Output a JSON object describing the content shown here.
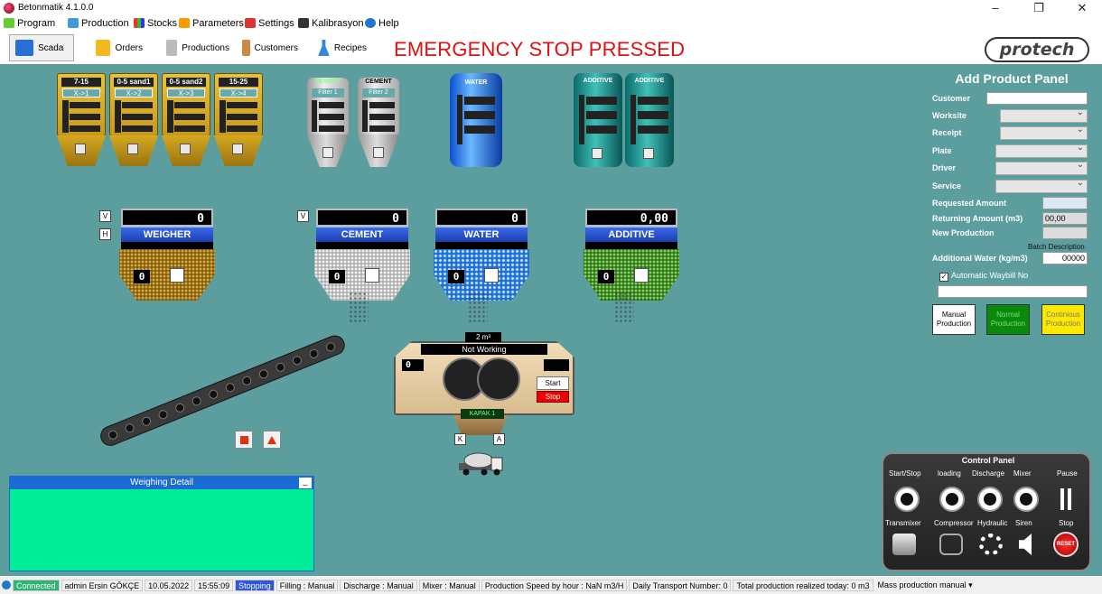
{
  "window": {
    "title": "Betonmatik 4.1.0.0",
    "minimize": "–",
    "restore": "❐",
    "close": "✕"
  },
  "menu": [
    "Program",
    "Production",
    "Stocks",
    "Parameters",
    "Settings",
    "Kalibrasyon",
    "Help"
  ],
  "toolbar": {
    "scada": "Scada",
    "orders": "Orders",
    "productions": "Productions",
    "customers": "Customers",
    "recipes": "Recipes"
  },
  "alert": "EMERGENCY STOP PRESSED",
  "logo": "protech",
  "bins": [
    {
      "label": "7-15",
      "sub": "X->1"
    },
    {
      "label": "0-5 sand1",
      "sub": "X->2"
    },
    {
      "label": "0-5 sand2",
      "sub": "X->3"
    },
    {
      "label": "15-25",
      "sub": "X->4"
    }
  ],
  "silos": [
    {
      "label": "CEMENT",
      "sub": "Filter 1"
    },
    {
      "label": "CEMENT",
      "sub": "Filter 2"
    }
  ],
  "water_tank": {
    "label": "WATER"
  },
  "additive_tanks": [
    {
      "label": "ADDITIVE"
    },
    {
      "label": "ADDITIVE"
    }
  ],
  "scales": [
    {
      "name": "WEIGHER",
      "value": "0",
      "count": "0"
    },
    {
      "name": "CEMENT",
      "value": "0",
      "count": "0"
    },
    {
      "name": "WATER",
      "value": "0",
      "count": "0"
    },
    {
      "name": "ADDITIVE",
      "value": "0,00",
      "count": "0"
    }
  ],
  "scale_buttons": {
    "v": "V",
    "h": "H",
    "v2": "V"
  },
  "mixer": {
    "size": "2 m³",
    "status": "Not Working",
    "count": "0",
    "start": "Start",
    "stop": "Stop",
    "gate": "KAPAK 1",
    "k": "K",
    "a": "A"
  },
  "weighing_detail": {
    "title": "Weighing Detail",
    "minimize": "_"
  },
  "add_product": {
    "title": "Add Product Panel",
    "customer": "Customer",
    "worksite": "Worksite",
    "receipt": "Receipt",
    "plate": "Plate",
    "driver": "Driver",
    "service": "Service",
    "requested_amount": "Requested Amount",
    "returning_amount": "Returning Amount (m3)",
    "returning_value": "00,00",
    "new_production": "New Production",
    "batch_description": "Batch Description",
    "additional_water": "Additional Water (kg/m3)",
    "additional_water_value": "00000",
    "auto_waybill": "Automatic Waybill No",
    "manual": "Manual Production",
    "normal": "Normal Production",
    "continuous": "Continious Production"
  },
  "control_panel": {
    "title": "Control Panel",
    "top_labels": [
      "Start/Stop",
      "loading",
      "Discharge",
      "Mixer",
      "Pause"
    ],
    "bottom_labels": [
      "Transmixer",
      "Compressor",
      "Hydraulic",
      "Siren",
      "Stop"
    ],
    "reset": "RESET"
  },
  "status": {
    "connected": "Connected",
    "user": "admin Ersin GÖKÇE",
    "date": "10.05.2022",
    "time": "15:55:09",
    "state": "Stopping",
    "filling": "Filling : Manual",
    "discharge": "Discharge : Manual",
    "mixer": "Mixer : Manual",
    "speed": "Production Speed by hour : NaN m3/H",
    "transport": "Daily Transport Number: 0",
    "total": "Total production realized today: 0 m3",
    "mass": "Mass production manual"
  },
  "colors": {
    "scada_bg": "#5c9e9e",
    "alert": "#e01010",
    "weighing_bg": "#00ee9a",
    "normal_btn": "#0a8a0a",
    "continuous_btn": "#ffe800"
  }
}
